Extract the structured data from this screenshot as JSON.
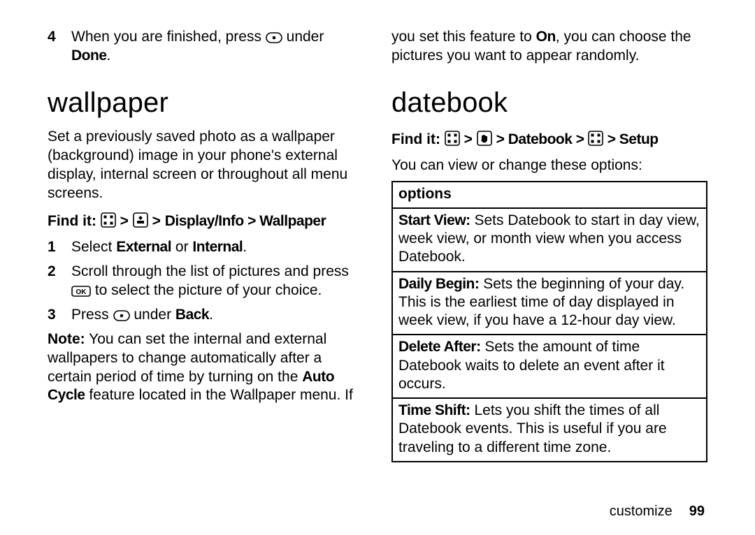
{
  "left": {
    "step4": {
      "num": "4",
      "t1": "When you are finished, press ",
      "t2": " under ",
      "done": "Done",
      "t3": "."
    },
    "h_wallpaper": "wallpaper",
    "wp_intro": "Set a previously saved photo as a wallpaper (background) image in your phone's external display, internal screen or throughout all menu screens.",
    "findit_label": "Find it:",
    "findit_path": " Display/Info > Wallpaper",
    "s1": {
      "num": "1",
      "t1": "Select ",
      "ext": "External",
      "or": " or ",
      "int": "Internal",
      "tail": "."
    },
    "s2": {
      "num": "2",
      "t1": "Scroll through the list of pictures and press ",
      "t2": " to select the picture of your choice."
    },
    "s3": {
      "num": "3",
      "t1": "Press ",
      "t2": " under ",
      "back": "Back",
      "tail": "."
    },
    "note_label": "Note:",
    "note_a": " You can set the internal and external wallpapers to change automatically after a certain period of time by turning on the ",
    "note_auto": "Auto Cycle",
    "note_b": " feature located in the Wallpaper menu. If"
  },
  "right": {
    "cont": "you set this feature to ",
    "on": "On",
    "cont2": ", you can choose the pictures you want to appear randomly.",
    "h_datebook": "datebook",
    "findit_label": "Find it:",
    "findit_mid": " Datebook > ",
    "findit_tail": " Setup",
    "view_change": "You can view or change these options:",
    "options_header": "options",
    "row1a": "Start View:",
    "row1b": " Sets Datebook to start in day view, week view, or month view when you access Datebook.",
    "row2a": "Daily Begin:",
    "row2b": " Sets the beginning of your day. This is the earliest time of day displayed in week view, if you have a 12-hour day view.",
    "row3a": "Delete After:",
    "row3b": " Sets the amount of time Datebook waits to delete an event after it occurs.",
    "row4a": "Time Shift:",
    "row4b": " Lets you shift the times of all Datebook events. This is useful if you are traveling to a different time zone."
  },
  "footer": {
    "section": "customize",
    "page": "99"
  }
}
